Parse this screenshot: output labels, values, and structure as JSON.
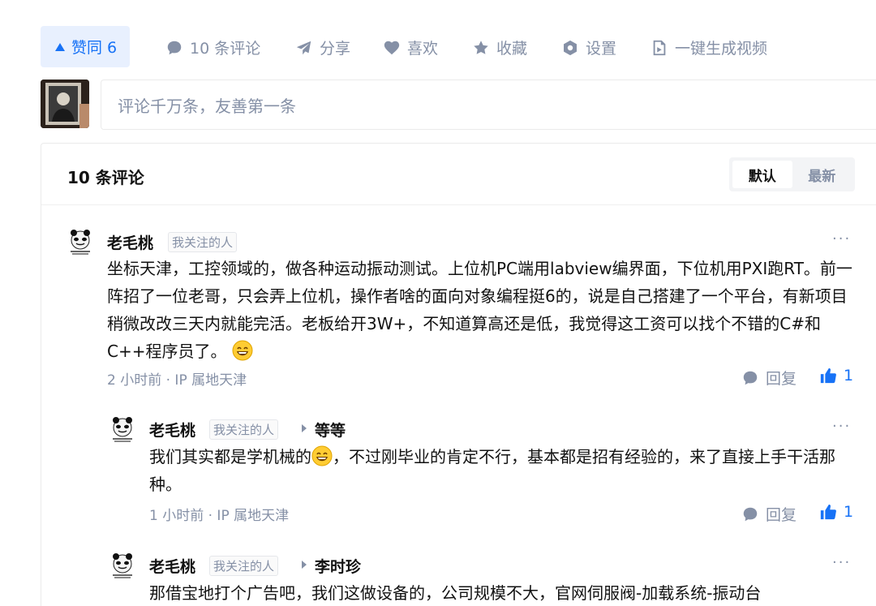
{
  "actions": {
    "vote_label": "赞同 6",
    "comments_label": "10 条评论",
    "share_label": "分享",
    "like_label": "喜欢",
    "favorite_label": "收藏",
    "settings_label": "设置",
    "video_label": "一键生成视频"
  },
  "comment_box": {
    "placeholder": "评论千万条，友善第一条"
  },
  "panel": {
    "title": "10 条评论",
    "sort_default": "默认",
    "sort_latest": "最新"
  },
  "comments": [
    {
      "author": "老毛桃",
      "tag": "我关注的人",
      "body": "坐标天津，工控领域的，做各种运动振动测试。上位机PC端用labview编界面，下位机用PXI跑RT。前一阵招了一位老哥，只会弄上位机，操作者啥的面向对象编程挺6的，说是自己搭建了一个平台，有新项目稍微改改三天内就能完活。老板给开3W+，不知道算高还是低，我觉得这工资可以找个不错的C#和C++程序员了。",
      "meta": "2 小时前 · IP 属地天津",
      "reply_label": "回复",
      "likes": "1"
    },
    {
      "author": "老毛桃",
      "tag": "我关注的人",
      "reply_to": "等等",
      "body_part1": "我们其实都是学机械的",
      "body_part2": "，不过刚毕业的肯定不行，基本都是招有经验的，来了直接上手干活那种。",
      "meta": "1 小时前 · IP 属地天津",
      "reply_label": "回复",
      "likes": "1"
    },
    {
      "author": "老毛桃",
      "tag": "我关注的人",
      "reply_to": "李时珍",
      "body": "那借宝地打个广告吧，我们这做设备的，公司规模不大，官网伺服阀-加载系统-振动台"
    }
  ],
  "colors": {
    "accent": "#1772f6",
    "muted": "#8590a6",
    "vote_bg": "#e8f0fe"
  }
}
